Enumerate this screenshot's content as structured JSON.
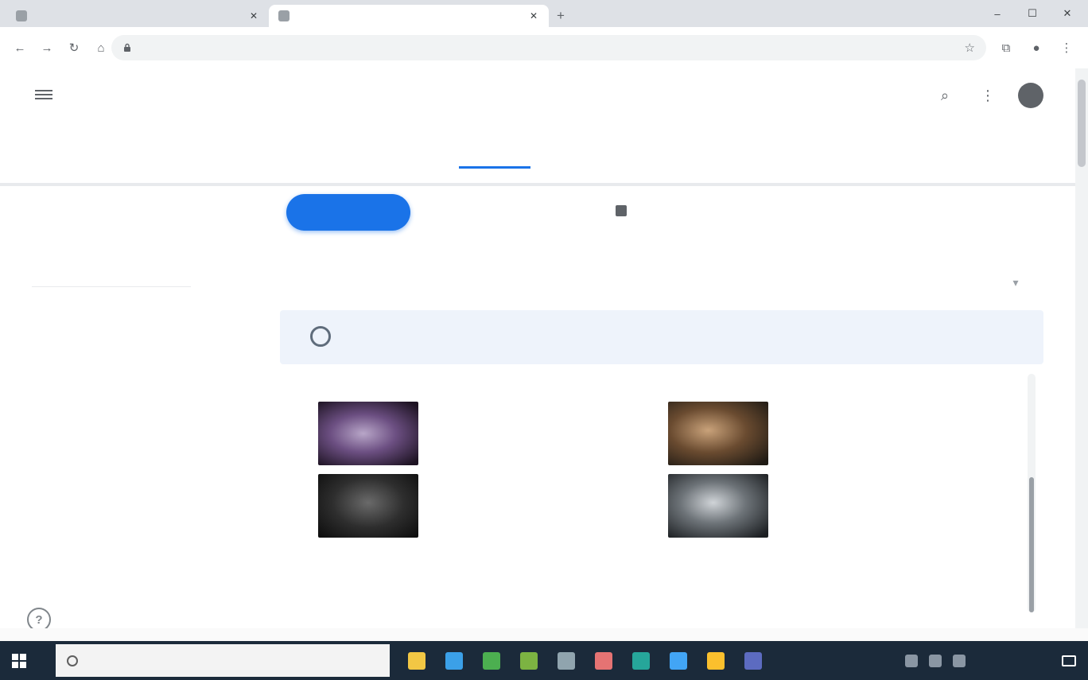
{
  "browser": {
    "tabs": [
      {
        "title": "",
        "active": false
      },
      {
        "title": "",
        "active": true
      }
    ],
    "new_tab_glyph": "+",
    "window_controls": {
      "minimize_glyph": "–",
      "maximize_glyph": "☐",
      "close_glyph": "✕"
    },
    "toolbar": {
      "back_glyph": "←",
      "forward_glyph": "→",
      "reload_glyph": "↻",
      "home_glyph": "⌂"
    },
    "address_bar": {
      "url": ""
    },
    "icons": [
      "lock-icon",
      "star-icon",
      "extensions-icon",
      "profile-icon",
      "menu-icon"
    ]
  },
  "site_header": {
    "title": "",
    "nav": [
      {
        "label": "",
        "active": false
      },
      {
        "label": "",
        "active": true
      },
      {
        "label": "",
        "active": false
      },
      {
        "label": "",
        "active": false
      }
    ],
    "icons": [
      "hamburger-icon",
      "search-icon",
      "apps-icon",
      "account-avatar"
    ]
  },
  "sidebar": {
    "items": [
      {
        "label": "",
        "active": true
      },
      {
        "label": "",
        "active": false
      },
      {
        "label": "",
        "active": false
      },
      {
        "label": "",
        "active": false
      },
      {
        "label": "",
        "active": false
      },
      {
        "label": "",
        "active": false
      },
      {
        "label": "",
        "active": false
      },
      {
        "label": "",
        "active": false
      }
    ],
    "help_glyph": "?"
  },
  "main": {
    "primary_button": "",
    "meta_line": "",
    "meta_sub": "",
    "heading": "",
    "heading_expand_glyph": "▾",
    "banner": {
      "text": "",
      "button": ""
    },
    "section_label": "",
    "cards": [
      {
        "title": "",
        "meta": "",
        "thumb": "v1"
      },
      {
        "title": "",
        "meta": "",
        "thumb": "v2"
      },
      {
        "title": "",
        "meta": "",
        "thumb": "v3"
      },
      {
        "title": "",
        "meta": "",
        "thumb": "v4"
      }
    ],
    "text_item": {
      "label": "",
      "description": ""
    }
  },
  "taskbar": {
    "search_placeholder": "",
    "pinned_apps": [
      {
        "icon": "file-explorer-icon",
        "color": "#f2c744"
      },
      {
        "icon": "browser-icon",
        "color": "#3ba0e8"
      },
      {
        "icon": "app-icon",
        "color": "#4caf50"
      },
      {
        "icon": "app-icon",
        "color": "#7cb342"
      },
      {
        "icon": "app-icon",
        "color": "#90a4ae"
      },
      {
        "icon": "app-icon",
        "color": "#e57373"
      },
      {
        "icon": "app-icon",
        "color": "#26a69a"
      },
      {
        "icon": "app-icon",
        "color": "#42a5f5"
      },
      {
        "icon": "app-icon",
        "color": "#fbc02d"
      },
      {
        "icon": "app-icon",
        "color": "#5c6bc0"
      }
    ],
    "clock_time": "",
    "clock_date": ""
  },
  "colors": {
    "accent": "#1a73e8",
    "banner_background": "#eef3fb",
    "taskbar_background": "#1b2a3a"
  }
}
